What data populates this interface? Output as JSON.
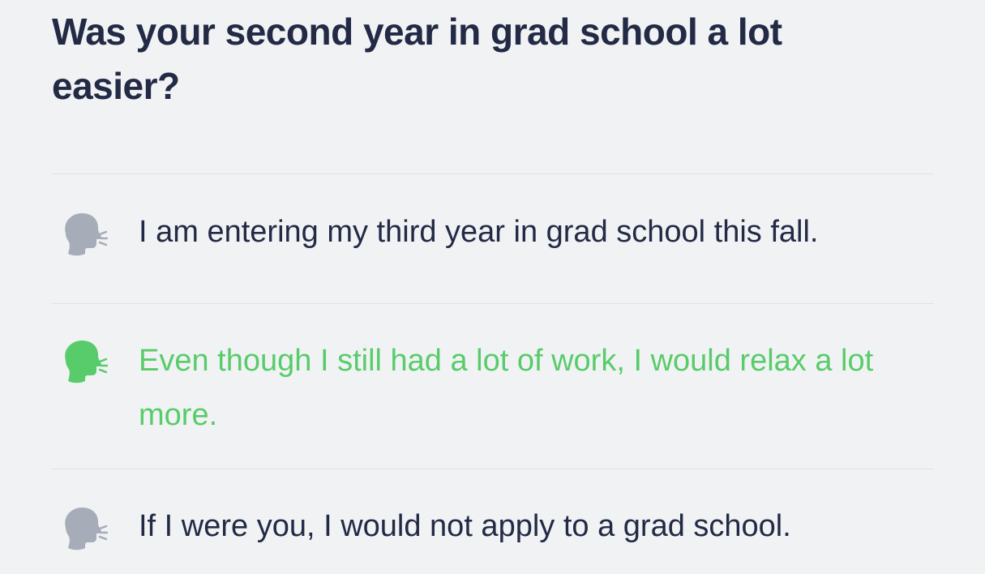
{
  "question": {
    "text": "Was your second year in grad school a lot easier?"
  },
  "options": [
    {
      "text": "I am entering my third year in grad school this fall.",
      "state": "default",
      "icon": "speaking-head-icon",
      "color": "#a6acb8"
    },
    {
      "text": "Even though I still had a lot of work, I would relax a lot more.",
      "state": "correct",
      "icon": "speaking-head-icon",
      "color": "#58cc6a"
    },
    {
      "text": "If I were you, I would not apply to a grad school.",
      "state": "default",
      "icon": "speaking-head-icon",
      "color": "#a6acb8"
    }
  ],
  "colors": {
    "background": "#f1f2f4",
    "text": "#222a45",
    "correct": "#58cc6a",
    "icon_default": "#a6acb8",
    "divider": "#dfe1e6"
  }
}
